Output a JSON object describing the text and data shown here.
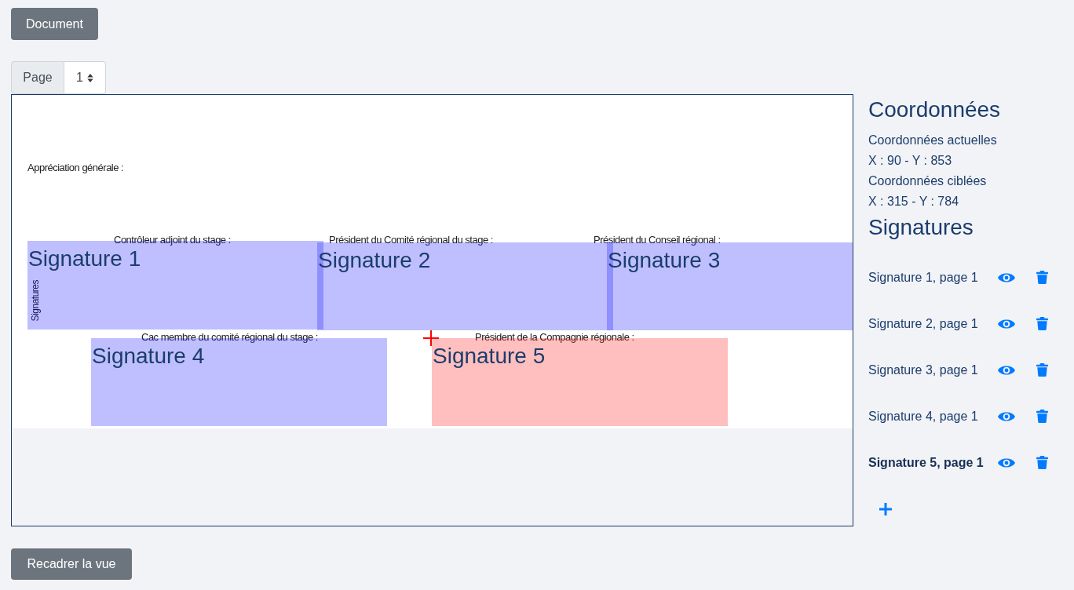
{
  "document_button": {
    "label": "Document"
  },
  "page_selector": {
    "label": "Page",
    "value": "1"
  },
  "viewer": {
    "page_texts": [
      "Appréciation générale :",
      "Contrôleur adjoint du stage :",
      "Président du Comité régional du stage :",
      "Président du Conseil régional :",
      "Cac membre du comité régional du stage :",
      "Président de la Compagnie régionale :"
    ],
    "side_text": "Signatures",
    "signature_zones": [
      {
        "label": "Signature 1",
        "selected": false
      },
      {
        "label": "Signature 2",
        "selected": false
      },
      {
        "label": "Signature 3",
        "selected": false
      },
      {
        "label": "Signature 4",
        "selected": false
      },
      {
        "label": "Signature 5",
        "selected": true
      }
    ]
  },
  "recenter_button": {
    "label": "Recadrer la vue"
  },
  "coordinates": {
    "title": "Coordonnées",
    "current_label": "Coordonnées actuelles",
    "current_value": "X : 90 - Y : 853",
    "target_label": "Coordonnées ciblées",
    "target_value": "X : 315 - Y : 784"
  },
  "signatures": {
    "title": "Signatures",
    "items": [
      {
        "label": "Signature 1, page 1",
        "selected": false
      },
      {
        "label": "Signature 2, page 1",
        "selected": false
      },
      {
        "label": "Signature 3, page 1",
        "selected": false
      },
      {
        "label": "Signature 4, page 1",
        "selected": false
      },
      {
        "label": "Signature 5, page 1",
        "selected": true
      }
    ]
  }
}
